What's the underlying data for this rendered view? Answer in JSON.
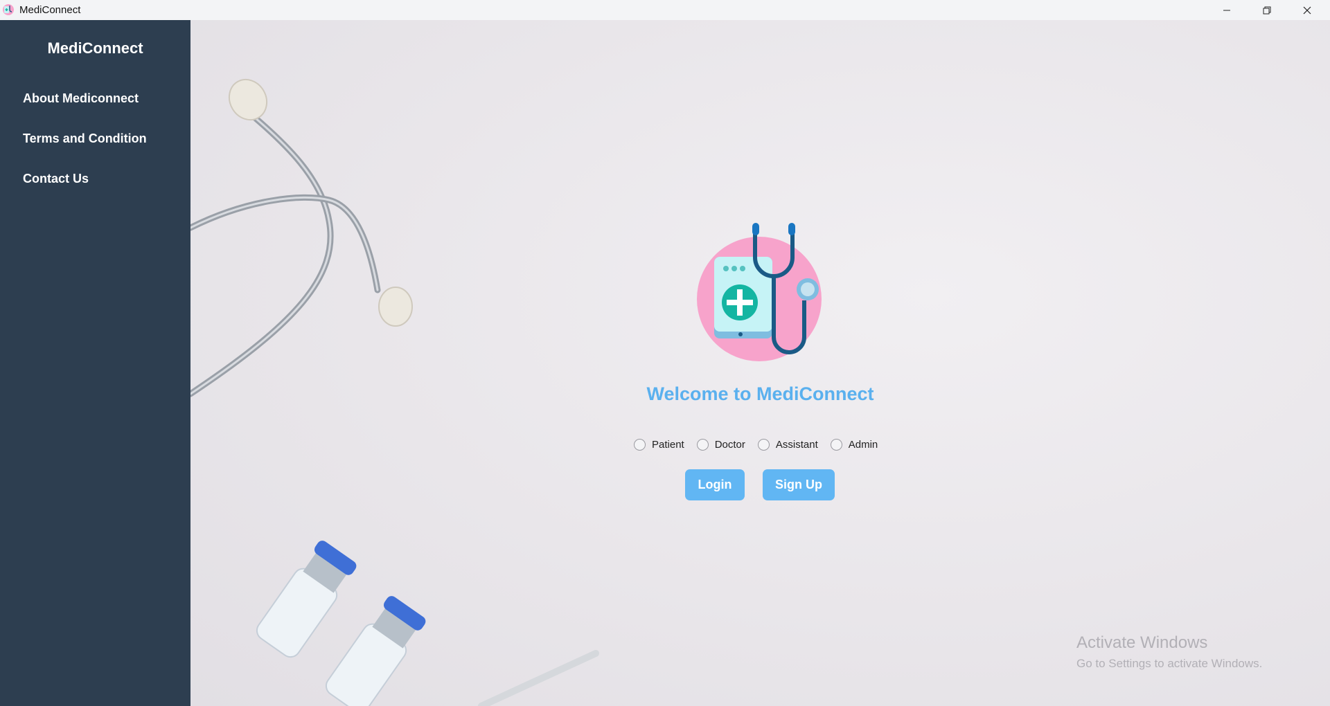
{
  "window": {
    "title": "MediConnect",
    "icons": {
      "app": "mediconnect-app-icon",
      "minimize": "minimize-icon",
      "maximize": "restore-icon",
      "close": "close-icon"
    }
  },
  "sidebar": {
    "brand": "MediConnect",
    "items": [
      {
        "label": "About Mediconnect"
      },
      {
        "label": "Terms and Condition"
      },
      {
        "label": "Contact Us"
      }
    ]
  },
  "main": {
    "logo_icon": "stethoscope-clipboard-icon",
    "welcome": "Welcome to MediConnect",
    "roles": [
      {
        "label": "Patient",
        "selected": false
      },
      {
        "label": "Doctor",
        "selected": false
      },
      {
        "label": "Assistant",
        "selected": false
      },
      {
        "label": "Admin",
        "selected": false
      }
    ],
    "login_label": "Login",
    "signup_label": "Sign Up"
  },
  "watermark": {
    "title": "Activate Windows",
    "subtitle": "Go to Settings to activate Windows."
  },
  "colors": {
    "sidebar_bg": "#2d3e50",
    "accent": "#61b6f3",
    "welcome_text": "#5ab0ee",
    "logo_circle": "#f7a3cb",
    "vial_cap": "#3f6fd6"
  }
}
